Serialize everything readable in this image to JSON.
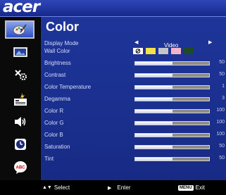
{
  "brand": "acer",
  "title": "Color",
  "rows": {
    "display_mode": {
      "label": "Display Mode",
      "value": "Video"
    },
    "wall_color": {
      "label": "Wall Color",
      "swatch_colors": [
        "#ffffff",
        "#f5e24a",
        "#c5c5c5",
        "#f0b6c8",
        "#1f4a26"
      ]
    },
    "brightness": {
      "label": "Brightness",
      "value": "50",
      "level": 0.5
    },
    "contrast": {
      "label": "Contrast",
      "value": "50",
      "level": 0.5
    },
    "color_temperature": {
      "label": "Color Temperature",
      "value": "1",
      "level": 0.5
    },
    "degamma": {
      "label": "Degamma",
      "value": "3",
      "level": 0.5
    },
    "color_r": {
      "label": "Color R",
      "value": "100",
      "level": 0.5
    },
    "color_g": {
      "label": "Color G",
      "value": "100",
      "level": 0.5
    },
    "color_b": {
      "label": "Color B",
      "value": "100",
      "level": 0.5
    },
    "saturation": {
      "label": "Saturation",
      "value": "50",
      "level": 0.5
    },
    "tint": {
      "label": "Tint",
      "value": "50",
      "level": 0.5
    }
  },
  "sidebar_icons": [
    "color-palette-icon",
    "image-icon",
    "management-icon",
    "setting-icon",
    "audio-icon",
    "timer-icon",
    "language-icon"
  ],
  "hints": {
    "select": "Select",
    "enter": "Enter",
    "menu_key": "MENU",
    "exit": "Exit"
  },
  "colors": {
    "accent": "#1e3599",
    "topbar": "#2f46b8",
    "sidebar_active": "#5d7be0"
  }
}
